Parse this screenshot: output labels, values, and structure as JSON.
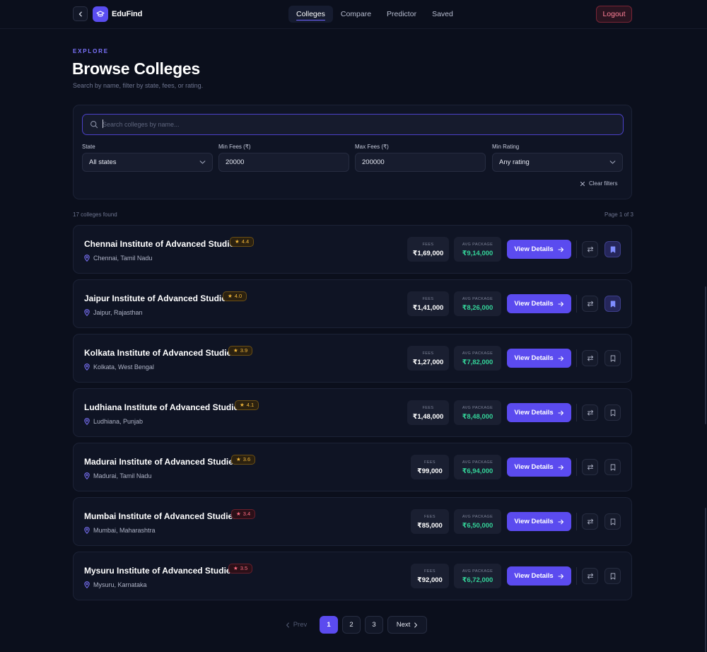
{
  "header": {
    "brand": "EduFind",
    "nav": [
      {
        "label": "Colleges",
        "active": true
      },
      {
        "label": "Compare",
        "active": false
      },
      {
        "label": "Predictor",
        "active": false
      },
      {
        "label": "Saved",
        "active": false
      }
    ],
    "logout_label": "Logout"
  },
  "page": {
    "eyebrow": "EXPLORE",
    "title": "Browse Colleges",
    "subtitle": "Search by name, filter by state, fees, or rating."
  },
  "filters": {
    "search_placeholder": "Search colleges by name...",
    "state_label": "State",
    "state_value": "All states",
    "min_fees_label": "Min Fees (₹)",
    "min_fees_value": "20000",
    "max_fees_label": "Max Fees (₹)",
    "max_fees_value": "200000",
    "min_rating_label": "Min Rating",
    "min_rating_value": "Any rating",
    "clear_label": "Clear filters"
  },
  "results": {
    "count_text": "17 colleges found",
    "page_text": "Page 1 of 3"
  },
  "card_labels": {
    "fees": "FEES",
    "avg_package": "AVG PACKAGE",
    "view_details": "View Details"
  },
  "colleges": [
    {
      "name": "Chennai Institute of Advanced Studies",
      "rating": "4.4",
      "location": "Chennai, Tamil Nadu",
      "fees": "₹1,69,000",
      "avg_package": "₹9,14,000",
      "saved": true
    },
    {
      "name": "Jaipur Institute of Advanced Studies",
      "rating": "4.0",
      "location": "Jaipur, Rajasthan",
      "fees": "₹1,41,000",
      "avg_package": "₹8,26,000",
      "saved": true
    },
    {
      "name": "Kolkata Institute of Advanced Studies",
      "rating": "3.9",
      "location": "Kolkata, West Bengal",
      "fees": "₹1,27,000",
      "avg_package": "₹7,82,000",
      "saved": false
    },
    {
      "name": "Ludhiana Institute of Advanced Studies",
      "rating": "4.1",
      "location": "Ludhiana, Punjab",
      "fees": "₹1,48,000",
      "avg_package": "₹8,48,000",
      "saved": false
    },
    {
      "name": "Madurai Institute of Advanced Studies",
      "rating": "3.6",
      "location": "Madurai, Tamil Nadu",
      "fees": "₹99,000",
      "avg_package": "₹6,94,000",
      "saved": false
    },
    {
      "name": "Mumbai Institute of Advanced Studies",
      "rating": "3.4",
      "location": "Mumbai, Maharashtra",
      "fees": "₹85,000",
      "avg_package": "₹6,50,000",
      "saved": false
    },
    {
      "name": "Mysuru Institute of Advanced Studies",
      "rating": "3.5",
      "location": "Mysuru, Karnataka",
      "fees": "₹92,000",
      "avg_package": "₹6,72,000",
      "saved": false
    }
  ],
  "pagination": {
    "prev_label": "Prev",
    "next_label": "Next",
    "pages": [
      "1",
      "2",
      "3"
    ],
    "current": "1"
  },
  "colors": {
    "accent": "#5b4bef",
    "background": "#0b0f1c",
    "card": "#0f1424",
    "package_green": "#34d399",
    "rating_gold": "#f2b73a",
    "rating_red": "#ff6b82",
    "logout_red": "#ff8097"
  },
  "icons": {
    "back": "chevron-left-icon",
    "logo": "graduation-cap-icon",
    "search": "search-icon",
    "dropdown": "chevron-down-icon",
    "clear": "close-icon",
    "location": "map-pin-icon",
    "rating": "star-icon",
    "view": "arrow-right-icon",
    "compare": "swap-arrows-icon",
    "save": "bookmark-icon"
  }
}
